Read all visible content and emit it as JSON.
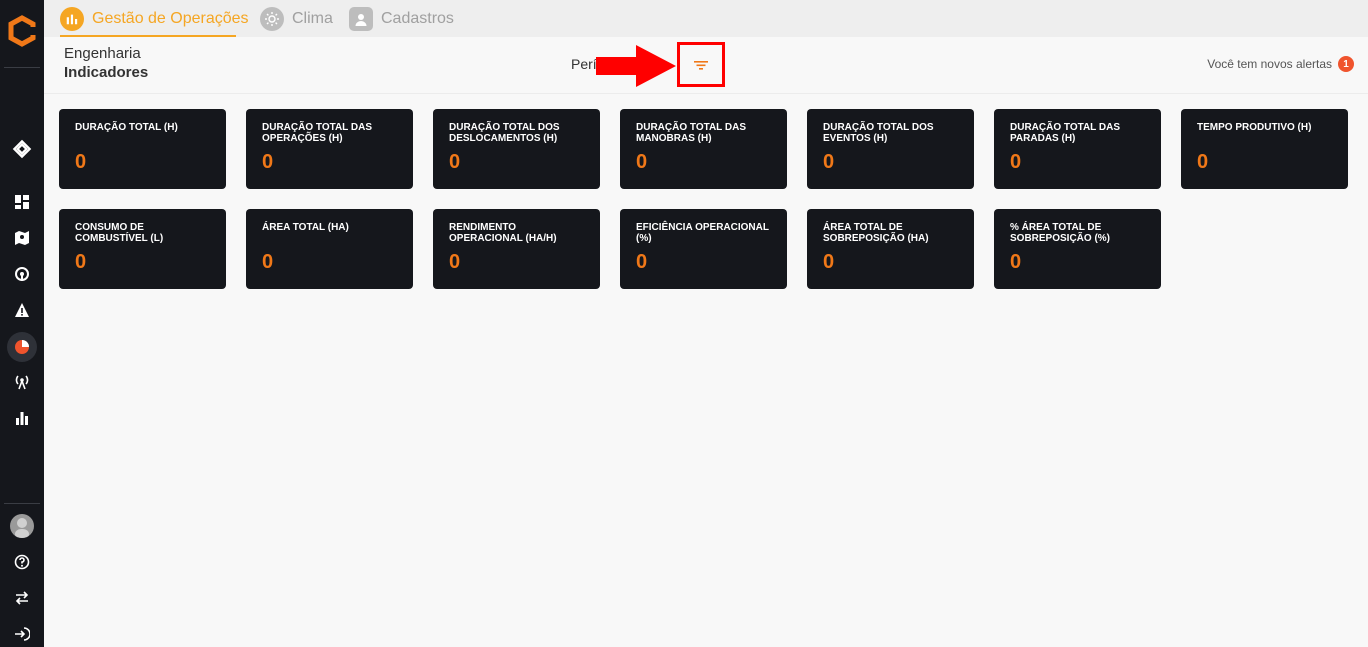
{
  "sidebar": {
    "icons": [
      "brand-logo-icon",
      "layers-icon",
      "dashboard-icon",
      "map-icon",
      "signal-icon",
      "alert-icon",
      "pie-chart-icon",
      "antenna-icon",
      "bar-chart-icon",
      "help-icon",
      "swap-icon",
      "logout-icon"
    ],
    "active": "pie-chart-icon"
  },
  "tabs": [
    {
      "label": "Gestão de Operações",
      "active": true
    },
    {
      "label": "Clima",
      "active": false
    },
    {
      "label": "Cadastros",
      "active": false
    }
  ],
  "header": {
    "breadcrumb_parent": "Engenharia",
    "breadcrumb_current": "Indicadores",
    "period_label": "Perí",
    "alerts_label": "Você tem novos alertas",
    "alerts_count": "1"
  },
  "cards": [
    {
      "title": "DURAÇÃO TOTAL (h)",
      "value": "0"
    },
    {
      "title": "DURAÇÃO TOTAL DAS OPERAÇÕES (h)",
      "value": "0"
    },
    {
      "title": "DURAÇÃO TOTAL DOS DESLOCAMENTOS (h)",
      "value": "0"
    },
    {
      "title": "DURAÇÃO TOTAL DAS MANOBRAS (h)",
      "value": "0"
    },
    {
      "title": "DURAÇÃO TOTAL DOS EVENTOS (h)",
      "value": "0"
    },
    {
      "title": "DURAÇÃO TOTAL DAS PARADAS (h)",
      "value": "0"
    },
    {
      "title": "TEMPO PRODUTIVO (h)",
      "value": "0"
    },
    {
      "title": "CONSUMO DE COMBUSTÍVEL (L)",
      "value": "0"
    },
    {
      "title": "ÁREA TOTAL (ha)",
      "value": "0"
    },
    {
      "title": "RENDIMENTO OPERACIONAL (ha/h)",
      "value": "0"
    },
    {
      "title": "EFICIÊNCIA OPERACIONAL (%)",
      "value": "0"
    },
    {
      "title": "ÁREA TOTAL DE SOBREPOSIÇÃO (ha)",
      "value": "0"
    },
    {
      "title": "% ÁREA TOTAL DE SOBREPOSIÇÃO (%)",
      "value": "0"
    }
  ],
  "colors": {
    "accent": "#f5a623",
    "value": "#f07818",
    "card_bg": "#15171c",
    "highlight": "#ff0000"
  }
}
